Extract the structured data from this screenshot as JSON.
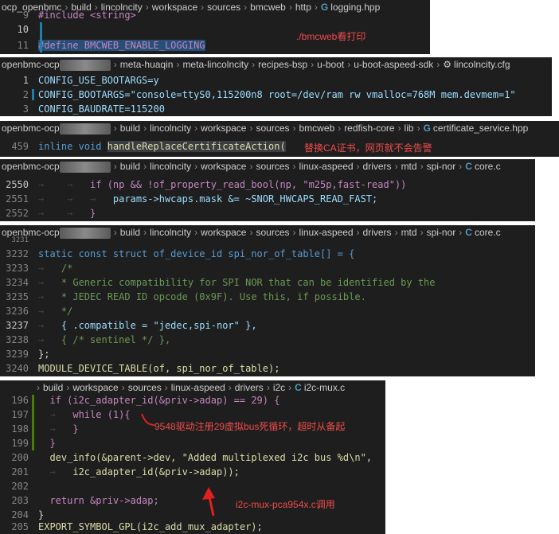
{
  "panel1": {
    "breadcrumb": [
      "ocp_openbmc",
      "build",
      "lincolncity",
      "workspace",
      "sources",
      "bmcweb",
      "http",
      "logging.hpp"
    ],
    "lines": [
      {
        "num": "9",
        "code": "#include <string>"
      },
      {
        "num": "10",
        "code": ""
      },
      {
        "num": "11",
        "code": "#define BMCWEB_ENABLE_LOGGING"
      }
    ],
    "note": "./bmcweb看打印"
  },
  "panel2": {
    "breadcrumb_prefix": "openbmc-ocp",
    "breadcrumb": [
      "meta-huaqin",
      "meta-lincolncity",
      "recipes-bsp",
      "u-boot",
      "u-boot-aspeed-sdk",
      "lincolncity.cfg"
    ],
    "lines": [
      {
        "num": "1",
        "code": "CONFIG_USE_BOOTARGS=y"
      },
      {
        "num": "2",
        "code": "CONFIG_BOOTARGS=\"console=ttyS0,115200n8 root=/dev/ram rw vmalloc=768M mem.devmem=1\""
      },
      {
        "num": "3",
        "code": "CONFIG_BAUDRATE=115200"
      }
    ]
  },
  "panel3": {
    "breadcrumb_prefix": "openbmc-ocp",
    "breadcrumb": [
      "build",
      "lincolncity",
      "workspace",
      "sources",
      "bmcweb",
      "redfish-core",
      "lib",
      "certificate_service.hpp"
    ],
    "line_num": "459",
    "code_inline": "inline",
    "code_void": "void",
    "code_fn": "handleReplaceCertificateAction(",
    "note": "替换CA证书，网页就不会告警"
  },
  "panel4": {
    "breadcrumb_prefix": "openbmc-ocp",
    "breadcrumb": [
      "build",
      "lincolncity",
      "workspace",
      "sources",
      "linux-aspeed",
      "drivers",
      "mtd",
      "spi-nor",
      "core.c"
    ],
    "lines": [
      {
        "num": "2550",
        "code": "if (np && !of_property_read_bool(np, \"m25p,fast-read\"))"
      },
      {
        "num": "2551",
        "code": "params->hwcaps.mask &= ~SNOR_HWCAPS_READ_FAST;"
      },
      {
        "num": "2552",
        "code": "}"
      }
    ]
  },
  "panel5": {
    "breadcrumb_prefix": "openbmc-ocp",
    "breadcrumb": [
      "build",
      "lincolncity",
      "workspace",
      "sources",
      "linux-aspeed",
      "drivers",
      "mtd",
      "spi-nor",
      "core.c"
    ],
    "lines": [
      {
        "num": "3231",
        "code": ""
      },
      {
        "num": "3232",
        "code": "static const struct of_device_id spi_nor_of_table[] = {"
      },
      {
        "num": "3233",
        "code": "/*"
      },
      {
        "num": "3234",
        "code": "* Generic compatibility for SPI NOR that can be identified by the"
      },
      {
        "num": "3235",
        "code": "* JEDEC READ ID opcode (0x9F). Use this, if possible."
      },
      {
        "num": "3236",
        "code": "*/"
      },
      {
        "num": "3237",
        "code": "{ .compatible = \"jedec,spi-nor\" },"
      },
      {
        "num": "3238",
        "code": "{ /* sentinel */ },"
      },
      {
        "num": "3239",
        "code": "};"
      },
      {
        "num": "3240",
        "code": "MODULE_DEVICE_TABLE(of, spi_nor_of_table);"
      }
    ]
  },
  "panel6": {
    "breadcrumb": [
      "build",
      "workspace",
      "sources",
      "linux-aspeed",
      "drivers",
      "i2c",
      "i2c-mux.c"
    ],
    "lines": [
      {
        "num": "196",
        "code": "if (i2c_adapter_id(&priv->adap) == 29) {"
      },
      {
        "num": "197",
        "code": "while (1){"
      },
      {
        "num": "198",
        "code": "}"
      },
      {
        "num": "199",
        "code": "}"
      },
      {
        "num": "200",
        "code": "dev_info(&parent->dev, \"Added multiplexed i2c bus %d\\n\","
      },
      {
        "num": "201",
        "code": "i2c_adapter_id(&priv->adap));"
      },
      {
        "num": "202",
        "code": ""
      },
      {
        "num": "203",
        "code": "return &priv->adap;"
      },
      {
        "num": "204",
        "code": "}"
      },
      {
        "num": "205",
        "code": "EXPORT_SYMBOL_GPL(i2c_add_mux_adapter);"
      }
    ],
    "note1": "9548驱动注册29虚拟bus死循环，超时从备起",
    "note2": "i2c-mux-pca954x.c调用"
  }
}
